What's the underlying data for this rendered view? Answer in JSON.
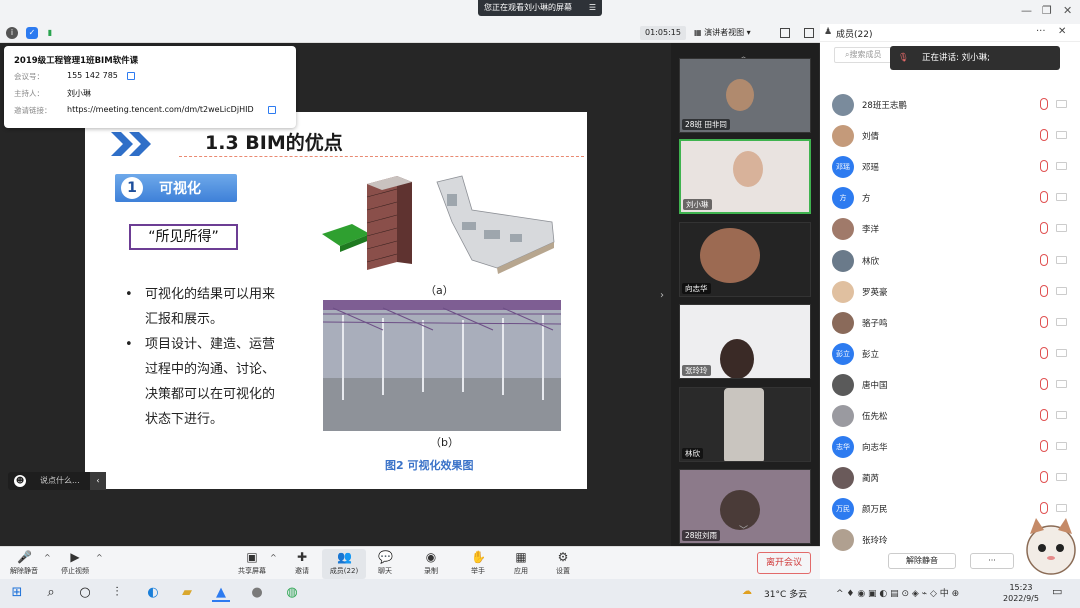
{
  "banner": {
    "text": "您正在观看刘小琳的屏幕",
    "menu": "☰"
  },
  "window": {
    "min": "—",
    "restore": "❐",
    "close": "✕",
    "pin": "⊞"
  },
  "toolbar_top": {
    "timer": "01:05:15",
    "view_label": "演讲者视图"
  },
  "info": {
    "title": "2019级工程管理1班BIM软件课",
    "meeting_id_label": "会议号：",
    "meeting_id": "155 142 785",
    "host_label": "主持人：",
    "host": "刘小琳",
    "link_label": "邀请链接：",
    "link": "https://meeting.tencent.com/dm/t2weLicDjHID"
  },
  "slide": {
    "title": "1.3  BIM的优点",
    "section_num": "1",
    "section_label": "可视化",
    "quote": "“所见所得”",
    "bullets": [
      [
        "可视化的结果可以用来",
        "汇报和展示。"
      ],
      [
        "项目设计、建造、运营",
        "过程中的沟通、讨论、",
        "决策都可以在可视化的",
        "状态下进行。"
      ]
    ],
    "bullet_mark": "•",
    "caption_a": "（a）",
    "caption_b": "（b）",
    "figure_caption": "图2   可视化效果图"
  },
  "chat": {
    "placeholder": "说点什么...",
    "emoji": "☻",
    "collapse": "‹"
  },
  "videos": [
    {
      "name": "28班 田非同"
    },
    {
      "name": "刘小琳"
    },
    {
      "name": "向志华"
    },
    {
      "name": "张玲玲"
    },
    {
      "name": "林欣"
    },
    {
      "name": "28班刘雨"
    }
  ],
  "panel": {
    "title": "成员(22)",
    "search_placeholder": "搜索成员",
    "speaking": "正在讲话: 刘小琳;",
    "members": [
      {
        "name": "28班王志鹏",
        "avatar": ""
      },
      {
        "name": "刘倩",
        "avatar": ""
      },
      {
        "name": "邓瑶",
        "avatar": "邓瑶"
      },
      {
        "name": "方",
        "avatar": "方"
      },
      {
        "name": "李洋",
        "avatar": ""
      },
      {
        "name": "林欣",
        "avatar": ""
      },
      {
        "name": "罗英豪",
        "avatar": ""
      },
      {
        "name": "骆子鸣",
        "avatar": ""
      },
      {
        "name": "彭立",
        "avatar": "彭立"
      },
      {
        "name": "唐中国",
        "avatar": ""
      },
      {
        "name": "伍先松",
        "avatar": ""
      },
      {
        "name": "向志华",
        "avatar": "志华"
      },
      {
        "name": "蔺芮",
        "avatar": ""
      },
      {
        "name": "颜万民",
        "avatar": "万民"
      },
      {
        "name": "张玲玲",
        "avatar": ""
      }
    ],
    "unmute_all": "解除静音",
    "more": "···"
  },
  "bottom_tools": [
    {
      "label": "解除静音",
      "icon": "🎤"
    },
    {
      "label": "停止视频",
      "icon": "▶"
    },
    {
      "label": "共享屏幕",
      "icon": "▣"
    },
    {
      "label": "邀请",
      "icon": "✚"
    },
    {
      "label": "成员(22)",
      "icon": "👥"
    },
    {
      "label": "聊天",
      "icon": "💬"
    },
    {
      "label": "录制",
      "icon": "◉"
    },
    {
      "label": "举手",
      "icon": "✋"
    },
    {
      "label": "应用",
      "icon": "▦"
    },
    {
      "label": "设置",
      "icon": "⚙"
    }
  ],
  "leave": "离开会议",
  "taskbar": {
    "weather": "31°C  多云",
    "time": "15:23",
    "date": "2022/9/5"
  },
  "colors": {
    "accent": "#2d7bf0",
    "leave": "#d03b3b",
    "active_video": "#3fb34f"
  }
}
